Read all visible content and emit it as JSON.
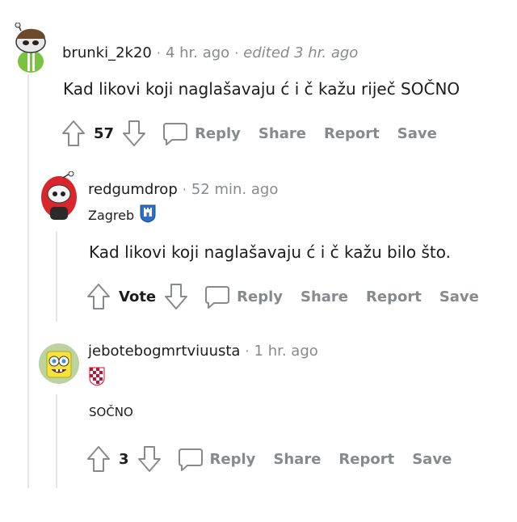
{
  "comments": [
    {
      "username": "brunki_2k20",
      "time": "4 hr. ago",
      "edited": "edited 3 hr. ago",
      "flair_text": "",
      "body": "Kad likovi koji naglašavaju ć i č kažu riječ SOČNO",
      "score": "57",
      "avatar": "snoo-avatar-green-shirt"
    },
    {
      "username": "redgumdrop",
      "time": "52 min. ago",
      "flair_text": "Zagreb",
      "flair_icon": "zagreb-coat-of-arms-icon",
      "body": "Kad likovi koji naglašavaju ć i č kažu bilo što.",
      "score": "Vote",
      "avatar": "snoo-avatar-red-hair"
    },
    {
      "username": "jebotebogmrtviuusta",
      "time": "1 hr. ago",
      "flair_icon": "croatia-checkerboard-icon",
      "body": "SOČNO",
      "score": "3",
      "avatar": "spongebob-avatar"
    }
  ],
  "actions": {
    "reply": "Reply",
    "share": "Share",
    "report": "Report",
    "save": "Save"
  },
  "separator": "·",
  "colors": {
    "meta_gray": "#878a8c",
    "text": "#1c1c1c",
    "thread_line": "#e6e6e6"
  }
}
